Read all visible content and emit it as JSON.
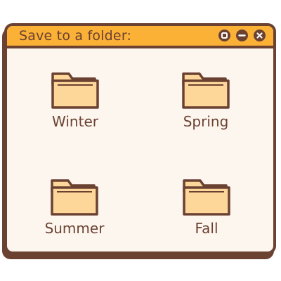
{
  "dialog": {
    "title": "Save to a folder:",
    "controls": [
      "maximize",
      "minimize",
      "close"
    ]
  },
  "folders": [
    {
      "label": "Winter",
      "icon": "folder-icon"
    },
    {
      "label": "Spring",
      "icon": "folder-icon"
    },
    {
      "label": "Summer",
      "icon": "folder-icon"
    },
    {
      "label": "Fall",
      "icon": "folder-icon"
    }
  ],
  "colors": {
    "titlebar": "#fbb036",
    "outline": "#6b4232",
    "background": "#fdf6ee",
    "folder_fill": "#fdd79a"
  }
}
